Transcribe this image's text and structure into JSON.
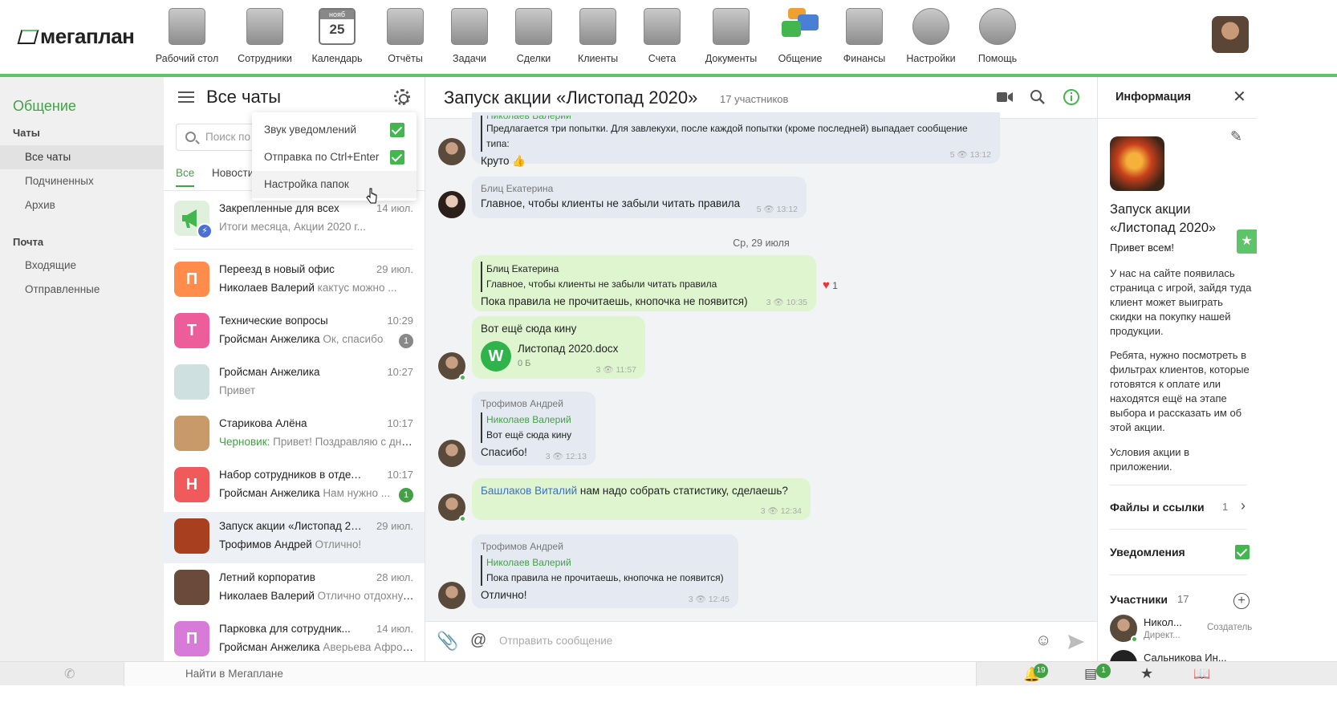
{
  "app": {
    "logo_text": "мегаплан"
  },
  "nav": [
    {
      "label": "Рабочий стол",
      "icon": "desktop-icon"
    },
    {
      "label": "Сотрудники",
      "icon": "employees-icon"
    },
    {
      "label": "Календарь",
      "icon": "calendar-icon",
      "month": "нояб",
      "day": "25"
    },
    {
      "label": "Отчёты",
      "icon": "reports-icon"
    },
    {
      "label": "Задачи",
      "icon": "tasks-icon"
    },
    {
      "label": "Сделки",
      "icon": "deals-icon"
    },
    {
      "label": "Клиенты",
      "icon": "clients-icon"
    },
    {
      "label": "Счета",
      "icon": "invoices-icon"
    },
    {
      "label": "Документы",
      "icon": "documents-icon"
    },
    {
      "label": "Общение",
      "icon": "chat-icon",
      "active": true
    },
    {
      "label": "Финансы",
      "icon": "safe-icon"
    },
    {
      "label": "Настройки",
      "icon": "settings-icon"
    },
    {
      "label": "Помощь",
      "icon": "lifebuoy-icon"
    }
  ],
  "sidebar": {
    "title": "Общение",
    "chats_section": "Чаты",
    "chat_items": [
      "Все чаты",
      "Подчиненных",
      "Архив"
    ],
    "mail_section": "Почта",
    "mail_items": [
      "Входящие",
      "Отправленные"
    ]
  },
  "chatlist": {
    "title": "Все чаты",
    "search_placeholder": "Поиск по",
    "tabs": [
      "Все",
      "Новости"
    ],
    "pinned": {
      "name": "Закрепленные для всех",
      "time": "14 июл.",
      "preview": "Итоги месяца, Акции 2020 г..."
    },
    "items": [
      {
        "initial": "П",
        "color": "#ff8c4a",
        "name": "Переезд в новый офис",
        "time": "29 июл.",
        "sender": "Николаев Валерий",
        "preview": "кактус можно ..."
      },
      {
        "initial": "Т",
        "color": "#ec5d9a",
        "name": "Технические вопросы",
        "time": "10:29",
        "sender": "Гройсман Анжелика",
        "preview": "Ок, спасибо",
        "badge": "1"
      },
      {
        "initial": "",
        "color": "#cfe0e0",
        "name": "Гройсман Анжелика",
        "time": "10:27",
        "sender": "",
        "preview": "Привет"
      },
      {
        "initial": "",
        "color": "#c89a6a",
        "name": "Старикова Алёна",
        "time": "10:17",
        "sender": "",
        "draft": "Черновик:",
        "preview": "Привет! Поздравляю с днё..."
      },
      {
        "initial": "Н",
        "color": "#f05a5a",
        "name": "Набор сотрудников в отдел пр...",
        "time": "10:17",
        "sender": "Гройсман Анжелика",
        "preview": "Нам нужно ...",
        "badge": "1"
      },
      {
        "initial": "",
        "color": "#a84020",
        "name": "Запуск акции «Листопад 20...",
        "time": "29 июл.",
        "sender": "Трофимов Андрей",
        "preview": "Отлично!"
      },
      {
        "initial": "",
        "color": "#6a4a3a",
        "name": "Летний корпоратив",
        "time": "28 июл.",
        "sender": "Николаев Валерий",
        "preview": "Отлично отдохнули!"
      },
      {
        "initial": "П",
        "color": "#d77ad8",
        "name": "Парковка для сотрудник...",
        "time": "14 июл.",
        "sender": "Гройсман Анжелика",
        "preview": "Аверьева Афрос..."
      }
    ]
  },
  "dropdown": {
    "items": [
      "Звук уведомлений",
      "Отправка по Ctrl+Enter",
      "Настройка папок"
    ]
  },
  "chat": {
    "title": "Запуск акции «Листопад 2020»",
    "participants": "17 участников",
    "messages": {
      "m1": {
        "quote_author": "Николаев Валерий",
        "quote_text": "Предлагается три попытки. Для завлекухи, после каждой попытки (кроме последней) выпадает сообщение типа:",
        "text": "Круто 👍",
        "views": "5",
        "time": "13:12"
      },
      "m2": {
        "sender": "Блиц Екатерина",
        "text": "Главное, чтобы клиенты не забыли читать правила",
        "views": "5",
        "time": "13:12"
      },
      "date": "Ср, 29 июля",
      "m3": {
        "quote_author": "Блиц Екатерина",
        "quote_text": "Главное, чтобы клиенты не забыли читать правила",
        "text": "Пока правила не прочитаешь, кнопочка не появится)",
        "views": "3",
        "time": "10:35",
        "reaction_count": "1"
      },
      "m4": {
        "text": "Вот ещё сюда кину",
        "file_name": "Листопад 2020.docx",
        "file_size": "0 Б",
        "views": "3",
        "time": "11:57"
      },
      "m5": {
        "sender": "Трофимов Андрей",
        "quote_author": "Николаев Валерий",
        "quote_text": "Вот ещё сюда кину",
        "text": "Спасибо!",
        "views": "3",
        "time": "12:13"
      },
      "m6": {
        "mention": "Башлаков Виталий",
        "text": "нам надо собрать статистику, сделаешь?",
        "views": "3",
        "time": "12:34"
      },
      "m7": {
        "sender": "Трофимов Андрей",
        "quote_author": "Николаев Валерий",
        "quote_text": "Пока правила не прочитаешь, кнопочка не появится)",
        "text": "Отлично!",
        "views": "3",
        "time": "12:45"
      }
    },
    "composer_placeholder": "Отправить сообщение"
  },
  "info": {
    "title": "Информация",
    "name": "Запуск акции «Листопад 2020»",
    "greeting": "Привет всем!",
    "p1": "У нас на сайте появилась страница с игрой, зайдя туда клиент может выиграть скидки на покупку нашей продукции.",
    "p2": "Ребята, нужно посмотреть в фильтрах клиентов, которые готовятся к оплате или находятся ещё на этапе выбора и рассказать им об этой акции.",
    "p3": "Условия акции в приложении.",
    "files_label": "Файлы и ссылки",
    "files_count": "1",
    "notifications_label": "Уведомления",
    "members_label": "Участники",
    "members_count": "17",
    "member1_name": "Никол...",
    "member1_role": "Директ...",
    "member1_tag": "Создатель",
    "member2_name": "Сальникова Ин..."
  },
  "bottombar": {
    "search_text": "Найти в Мегаплане",
    "notif_count": "19",
    "msg_count": "1"
  },
  "colors": {
    "accent": "#5ec46a",
    "green_text": "#43a047",
    "in_bubble": "#e4e9f2",
    "out_bubble": "#dff5cf"
  }
}
